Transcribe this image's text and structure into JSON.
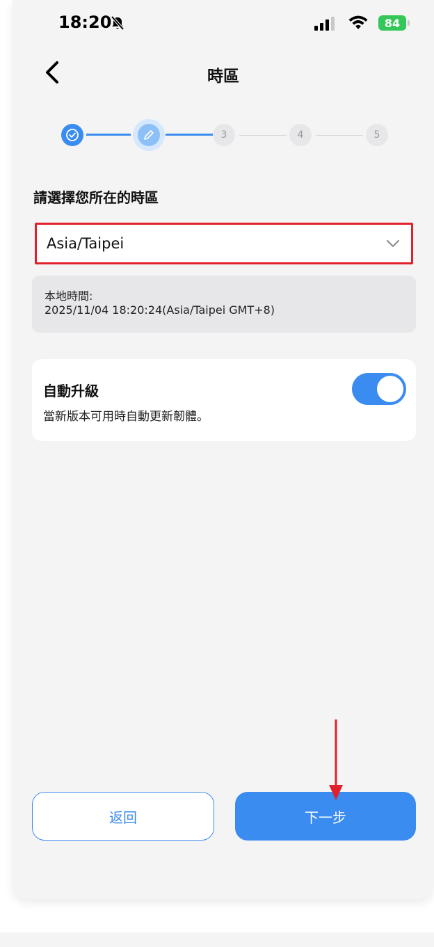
{
  "status_bar": {
    "time": "18:20",
    "battery": "84"
  },
  "nav": {
    "title": "時區"
  },
  "stepper": {
    "steps": [
      "3",
      "4",
      "5"
    ]
  },
  "timezone": {
    "question": "請選擇您所在的時區",
    "selected": "Asia/Taipei",
    "local_time_label": "本地時間:",
    "local_time_value": "2025/11/04 18:20:24(Asia/Taipei GMT+8)"
  },
  "auto_upgrade": {
    "title": "自動升級",
    "description": "當新版本可用時自動更新韌體。",
    "enabled": true
  },
  "actions": {
    "back_label": "返回",
    "next_label": "下一步"
  },
  "colors": {
    "accent": "#3b8cf0",
    "highlight_border": "#e0212b",
    "battery": "#34c759"
  }
}
